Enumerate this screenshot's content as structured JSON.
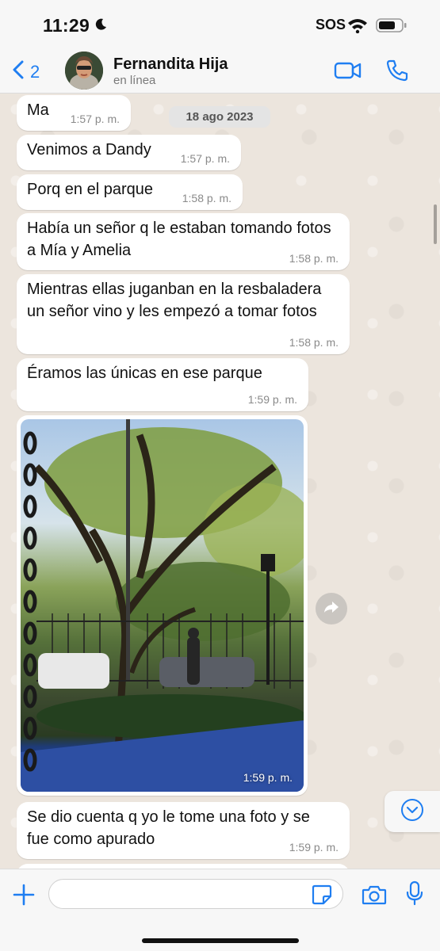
{
  "status_bar": {
    "time": "11:29",
    "sos": "SOS"
  },
  "header": {
    "back_count": "2",
    "contact_name": "Fernandita Hija",
    "contact_status": "en línea"
  },
  "chat": {
    "date_label": "18 ago 2023",
    "messages": [
      {
        "text": "Ma",
        "time": "1:57 p. m."
      },
      {
        "text": "Venimos a Dandy",
        "time": "1:57 p. m."
      },
      {
        "text": "Porq en el parque",
        "time": "1:58 p. m."
      },
      {
        "text": "Había un señor q le estaban tomando fotos a Mía y Amelia",
        "time": "1:58 p. m."
      },
      {
        "text": "Mientras ellas juganban en la resbaladera un señor vino y les empezó a tomar fotos",
        "time": "1:58 p. m."
      },
      {
        "text": "Éramos las únicas en ese parque",
        "time": "1:59 p. m."
      },
      {
        "text": "Se dio cuenta q yo le tome una foto y se fue como apurado",
        "time": "1:59 p. m."
      }
    ],
    "photo_time": "1:59 p. m."
  },
  "input": {
    "placeholder": ""
  },
  "colors": {
    "accent": "#1f7ef1",
    "chat_bg": "#ece5dd",
    "bubble_bg": "#ffffff"
  },
  "icons": {
    "back": "chevron-left-icon",
    "video": "video-camera-icon",
    "phone": "phone-icon",
    "forward": "forward-arrow-icon",
    "scroll_down": "chevron-down-icon",
    "plus": "plus-icon",
    "sticker": "sticker-icon",
    "camera": "camera-icon",
    "mic": "microphone-icon"
  }
}
